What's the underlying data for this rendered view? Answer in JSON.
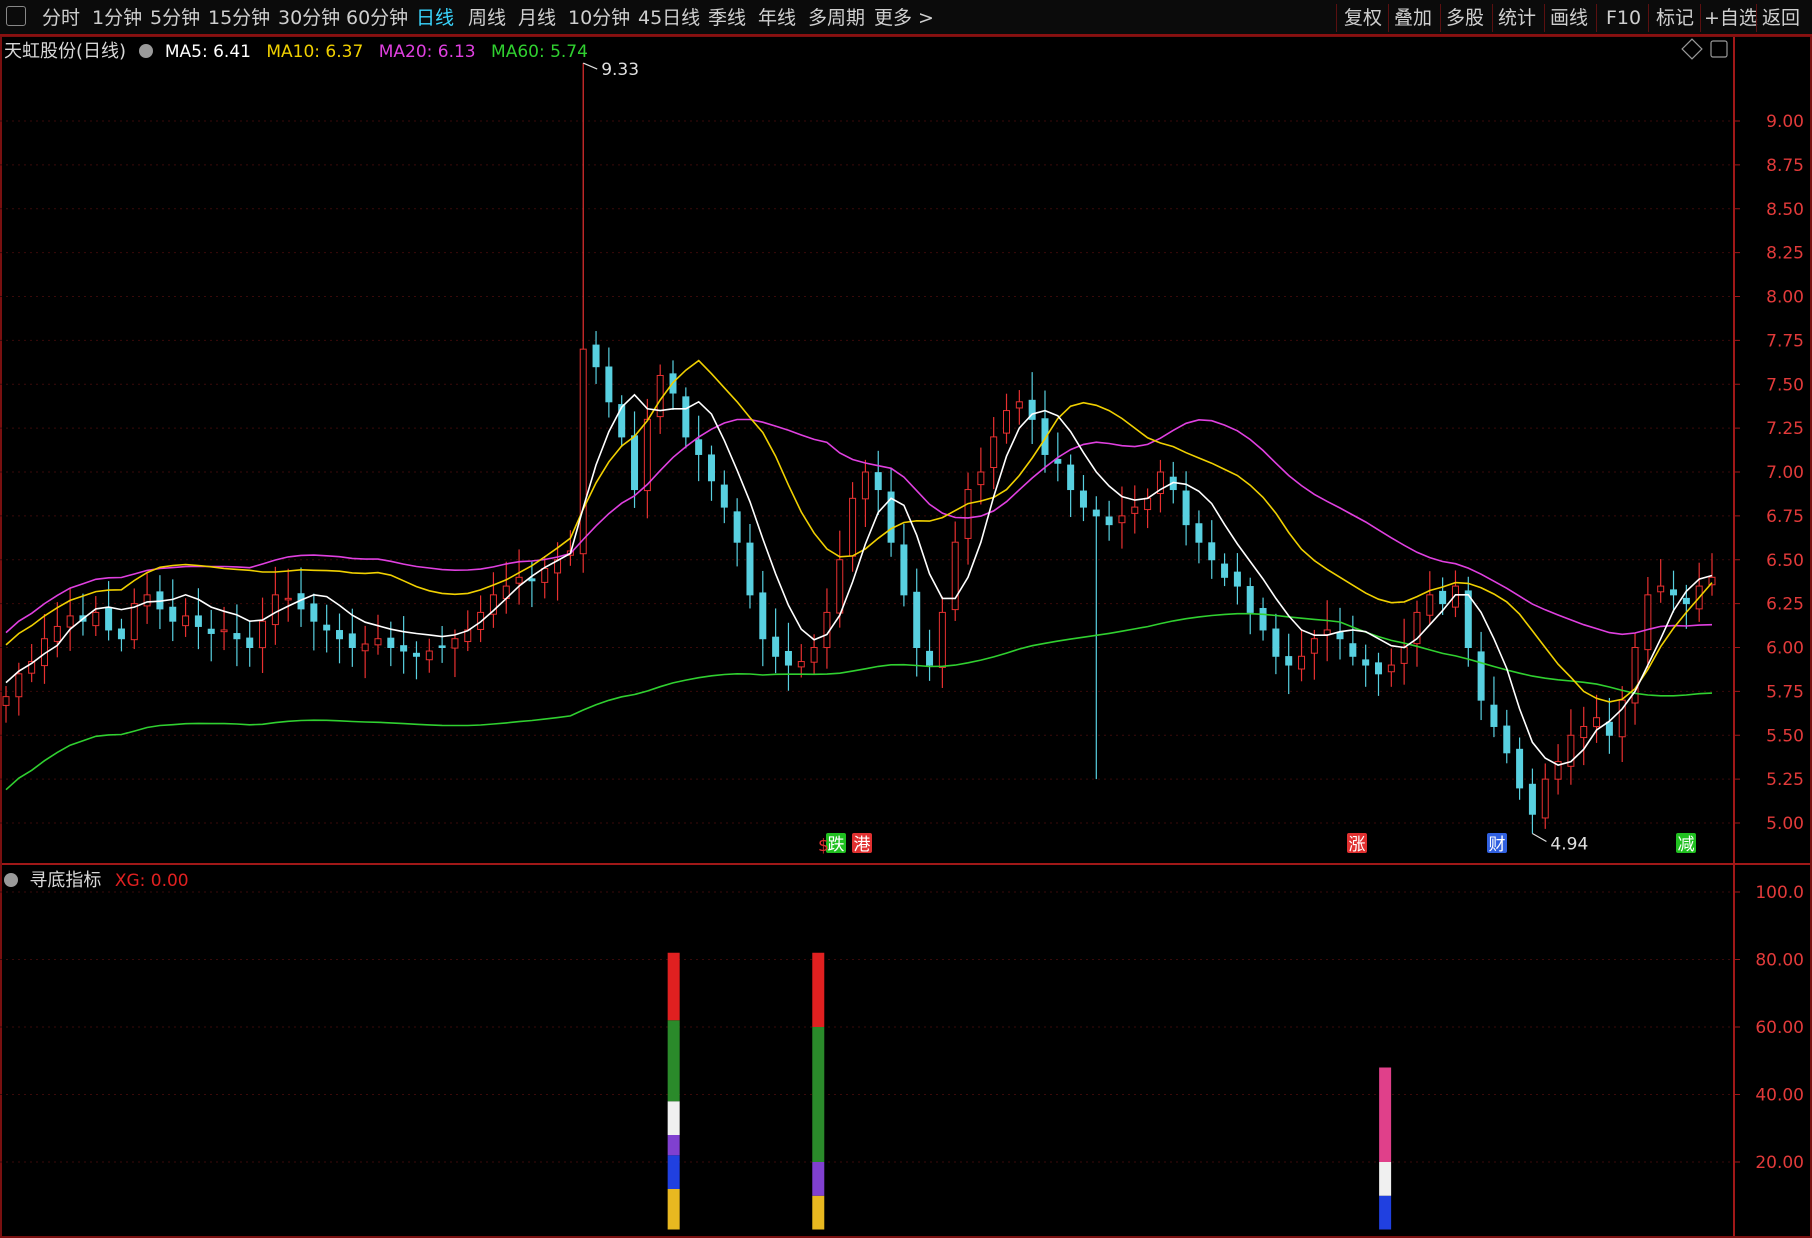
{
  "toolbar": {
    "left_items": [
      "分时",
      "1分钟",
      "5分钟",
      "15分钟",
      "30分钟",
      "60分钟",
      "日线",
      "周线",
      "月线",
      "10分钟",
      "45日线",
      "季线",
      "年线",
      "多周期",
      "更多 >"
    ],
    "active_item": "日线",
    "right_items": [
      "复权",
      "叠加",
      "多股",
      "统计",
      "画线",
      "F10",
      "标记",
      "+自选",
      "返回"
    ]
  },
  "main_chart": {
    "title": "天虹股份(日线)",
    "ma": [
      {
        "label": "MA5: 6.41",
        "color": "#ffffff"
      },
      {
        "label": "MA10: 6.37",
        "color": "#f0d000"
      },
      {
        "label": "MA20: 6.13",
        "color": "#e040e0"
      },
      {
        "label": "MA60: 5.74",
        "color": "#30d030"
      }
    ],
    "high_label": "9.33",
    "low_label": "4.94",
    "markers": [
      {
        "text": "跌",
        "color": "#20c020"
      },
      {
        "text": "港",
        "color": "#e03030"
      },
      {
        "text": "涨",
        "color": "#e03030"
      },
      {
        "text": "财",
        "color": "#3060e0"
      },
      {
        "text": "减",
        "color": "#20c020"
      }
    ],
    "ylim": [
      4.75,
      9.33
    ]
  },
  "indicator": {
    "title": "寻底指标",
    "xg_label": "XG: 0.00",
    "ylim": [
      0,
      105
    ]
  },
  "chart_data": [
    {
      "type": "candlestick",
      "title": "天虹股份(日线)",
      "y_ticks": [
        "9.00",
        "8.75",
        "8.50",
        "8.25",
        "8.00",
        "7.75",
        "7.50",
        "7.25",
        "7.00",
        "6.75",
        "6.50",
        "6.25",
        "6.00",
        "5.75",
        "5.50",
        "5.25",
        "5.00"
      ],
      "close": [
        5.72,
        5.85,
        5.92,
        6.05,
        6.12,
        6.18,
        6.15,
        6.2,
        6.1,
        6.05,
        6.25,
        6.3,
        6.22,
        6.15,
        6.18,
        6.12,
        6.08,
        6.1,
        6.05,
        6.0,
        6.15,
        6.3,
        6.28,
        6.22,
        6.15,
        6.1,
        6.05,
        6.0,
        6.02,
        6.05,
        6.0,
        5.98,
        5.95,
        5.98,
        6.0,
        6.05,
        6.1,
        6.2,
        6.3,
        6.35,
        6.4,
        6.38,
        6.45,
        6.5,
        6.55,
        7.7,
        7.6,
        7.4,
        7.2,
        6.9,
        7.3,
        7.55,
        7.45,
        7.2,
        7.1,
        6.95,
        6.8,
        6.6,
        6.3,
        6.05,
        5.95,
        5.9,
        5.92,
        6.0,
        6.2,
        6.5,
        6.85,
        7.0,
        6.9,
        6.6,
        6.3,
        6.0,
        5.9,
        6.2,
        6.6,
        6.9,
        7.0,
        7.2,
        7.35,
        7.4,
        7.3,
        7.1,
        7.05,
        6.9,
        6.8,
        6.75,
        6.7,
        6.75,
        6.8,
        6.85,
        7.0,
        6.9,
        6.7,
        6.6,
        6.5,
        6.4,
        6.35,
        6.2,
        6.1,
        5.95,
        5.9,
        5.95,
        6.05,
        6.1,
        6.05,
        5.95,
        5.9,
        5.85,
        5.9,
        6.0,
        6.2,
        6.3,
        6.25,
        6.35,
        6.0,
        5.7,
        5.55,
        5.4,
        5.2,
        5.05,
        5.25,
        5.35,
        5.5,
        5.55,
        5.6,
        5.5,
        5.7,
        6.0,
        6.3,
        6.35,
        6.3,
        6.25,
        6.35,
        6.4
      ],
      "ma5_last": 6.41,
      "ma10_last": 6.37,
      "ma20_last": 6.13,
      "ma60_last": 5.74,
      "high": 9.33,
      "low": 4.94
    },
    {
      "type": "bar",
      "title": "寻底指标",
      "y_ticks": [
        "100.0",
        "80.00",
        "60.00",
        "40.00",
        "20.00"
      ],
      "bars": [
        {
          "pos": 0.3885,
          "segments": [
            {
              "from": 0,
              "to": 12,
              "color": "#e8b820"
            },
            {
              "from": 12,
              "to": 22,
              "color": "#2040e0"
            },
            {
              "from": 22,
              "to": 28,
              "color": "#8040d0"
            },
            {
              "from": 28,
              "to": 38,
              "color": "#f0f0f0"
            },
            {
              "from": 38,
              "to": 62,
              "color": "#2a8a2a"
            },
            {
              "from": 62,
              "to": 82,
              "color": "#e02020"
            }
          ]
        },
        {
          "pos": 0.4719,
          "segments": [
            {
              "from": 0,
              "to": 10,
              "color": "#e8b820"
            },
            {
              "from": 10,
              "to": 20,
              "color": "#8040d0"
            },
            {
              "from": 20,
              "to": 60,
              "color": "#2a8a2a"
            },
            {
              "from": 60,
              "to": 82,
              "color": "#e02020"
            }
          ]
        },
        {
          "pos": 0.7988,
          "segments": [
            {
              "from": 0,
              "to": 10,
              "color": "#2040e0"
            },
            {
              "from": 10,
              "to": 20,
              "color": "#f0f0f0"
            },
            {
              "from": 20,
              "to": 48,
              "color": "#e0408a"
            }
          ]
        }
      ]
    }
  ]
}
